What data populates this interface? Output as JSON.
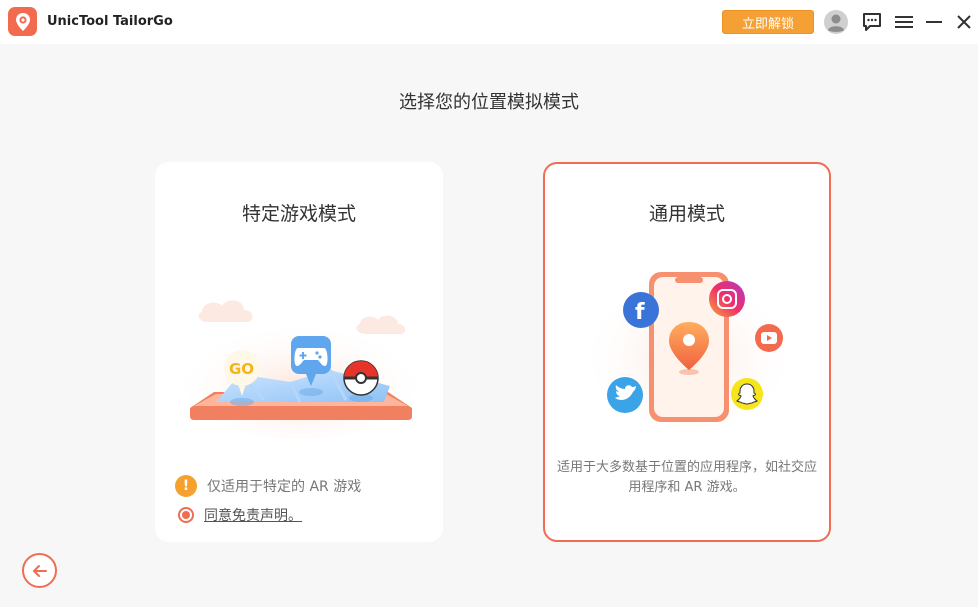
{
  "app": {
    "title": "UnicTool TailorGo"
  },
  "toolbar": {
    "unlock_label": "立即解锁"
  },
  "page": {
    "title": "选择您的位置模拟模式"
  },
  "cards": {
    "game": {
      "title": "特定游戏模式",
      "note": "仅适用于特定的 AR 游戏",
      "agree_link": "同意免责声明。",
      "go_badge": "GO"
    },
    "general": {
      "title": "通用模式",
      "description": "适用于大多数基于位置的应用程序，如社交应用程序和 AR 游戏。"
    }
  },
  "colors": {
    "accent": "#f06c53",
    "unlock": "#f5a035",
    "warning": "#f6a02e"
  },
  "icons": [
    "location-logo-icon",
    "user-avatar-icon",
    "chat-icon",
    "menu-icon",
    "minimize-icon",
    "close-icon",
    "back-arrow-icon",
    "gamepad-icon",
    "pokeball-icon",
    "facebook-icon",
    "instagram-icon",
    "youtube-icon",
    "twitter-icon",
    "snapchat-icon",
    "location-pin-icon"
  ]
}
